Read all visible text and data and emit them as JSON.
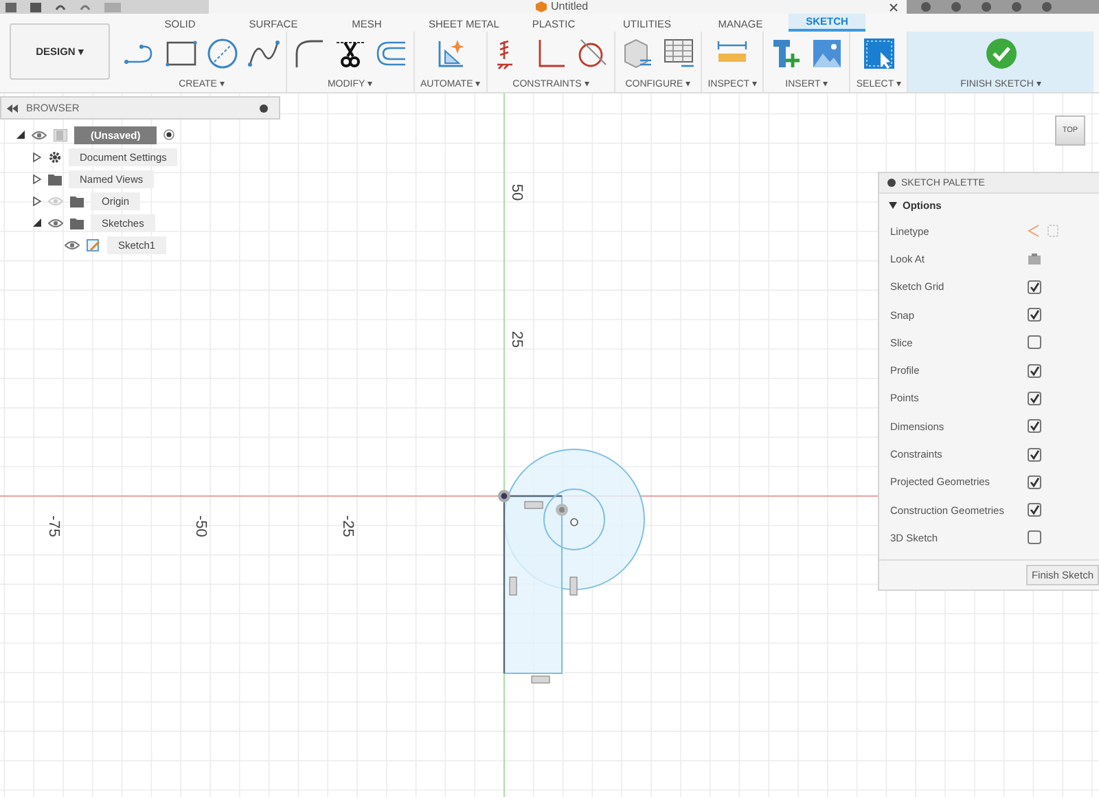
{
  "window": {
    "title": "Untitled"
  },
  "workspace": {
    "label": "DESIGN ▾"
  },
  "tabs": [
    {
      "label": "SOLID",
      "selected": false
    },
    {
      "label": "SURFACE",
      "selected": false
    },
    {
      "label": "MESH",
      "selected": false
    },
    {
      "label": "SHEET METAL",
      "selected": false
    },
    {
      "label": "PLASTIC",
      "selected": false
    },
    {
      "label": "UTILITIES",
      "selected": false
    },
    {
      "label": "MANAGE",
      "selected": false
    },
    {
      "label": "SKETCH",
      "selected": true
    }
  ],
  "ribbon": {
    "groups": [
      {
        "label": "CREATE ▾",
        "highlighted": false
      },
      {
        "label": "MODIFY ▾",
        "highlighted": false
      },
      {
        "label": "AUTOMATE ▾",
        "highlighted": false
      },
      {
        "label": "CONSTRAINTS ▾",
        "highlighted": false
      },
      {
        "label": "CONFIGURE ▾",
        "highlighted": false
      },
      {
        "label": "INSPECT ▾",
        "highlighted": false
      },
      {
        "label": "INSERT ▾",
        "highlighted": false
      },
      {
        "label": "SELECT ▾",
        "highlighted": false
      },
      {
        "label": "FINISH SKETCH ▾",
        "highlighted": true
      }
    ]
  },
  "browser": {
    "title": "BROWSER",
    "items": [
      {
        "label": "(Unsaved)",
        "kind": "component",
        "active": true,
        "expanded": true,
        "visible": true,
        "children": [
          {
            "label": "Document Settings",
            "kind": "settings",
            "active": false,
            "expanded": false
          },
          {
            "label": "Named Views",
            "kind": "folder",
            "active": false,
            "expanded": false
          },
          {
            "label": "Origin",
            "kind": "folder",
            "active": false,
            "expanded": false,
            "visible": false
          },
          {
            "label": "Sketches",
            "kind": "folder",
            "active": false,
            "expanded": true,
            "visible": true,
            "children": [
              {
                "label": "Sketch1",
                "kind": "sketch",
                "active": false,
                "visible": true
              }
            ]
          }
        ]
      }
    ]
  },
  "canvas": {
    "x_labels": [
      "-75",
      "-50",
      "-25"
    ],
    "y_labels": [
      "50",
      "25"
    ],
    "view_cube": "TOP"
  },
  "palette": {
    "title": "SKETCH PALETTE",
    "section": "Options",
    "expanded": true,
    "options": [
      {
        "label": "Linetype",
        "kind": "linetype"
      },
      {
        "label": "Look At",
        "kind": "button"
      },
      {
        "label": "Sketch Grid",
        "kind": "checkbox",
        "checked": true
      },
      {
        "label": "Snap",
        "kind": "checkbox",
        "checked": true
      },
      {
        "label": "Slice",
        "kind": "checkbox",
        "checked": false
      },
      {
        "label": "Profile",
        "kind": "checkbox",
        "checked": true
      },
      {
        "label": "Points",
        "kind": "checkbox",
        "checked": true
      },
      {
        "label": "Dimensions",
        "kind": "checkbox",
        "checked": true
      },
      {
        "label": "Constraints",
        "kind": "checkbox",
        "checked": true
      },
      {
        "label": "Projected Geometries",
        "kind": "checkbox",
        "checked": true
      },
      {
        "label": "Construction Geometries",
        "kind": "checkbox",
        "checked": true
      },
      {
        "label": "3D Sketch",
        "kind": "checkbox",
        "checked": false
      }
    ],
    "button": "Finish Sketch"
  }
}
